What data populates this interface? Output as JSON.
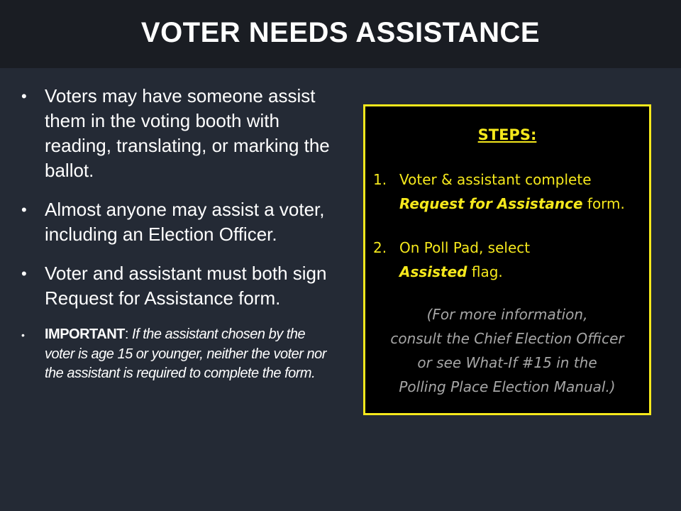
{
  "title": "VOTER NEEDS ASSISTANCE",
  "bullets": {
    "b1": "Voters may have someone assist them in the voting booth with reading, translating, or marking the ballot.",
    "b2": "Almost anyone may assist a voter, including an Election Officer.",
    "b3": "Voter and assistant must both sign Request for Assistance form.",
    "b4_label": "IMPORTANT",
    "b4_colon": ": ",
    "b4_text": "If the assistant chosen by the voter is age 15 or younger, neither the voter nor the assistant is required to complete the form.",
    "marker": "•"
  },
  "steps": {
    "heading": "STEPS:",
    "s1_num": "1.",
    "s1_pre": "Voter & assistant complete ",
    "s1_ital": "Request for Assistance",
    "s1_post": " form.",
    "s2_num": "2.",
    "s2_pre": "On Poll Pad, select ",
    "s2_ital": "Assisted",
    "s2_post": " flag.",
    "note_l1": "(For more information,",
    "note_l2": "consult the Chief Election Officer",
    "note_l3": "or see What-If #15 in the",
    "note_l4": "Polling Place Election Manual.)"
  },
  "colors": {
    "background": "#242a35",
    "title_bar": "#1a1d23",
    "accent_yellow": "#f5e81c",
    "note_gray": "#a6a6a6"
  }
}
